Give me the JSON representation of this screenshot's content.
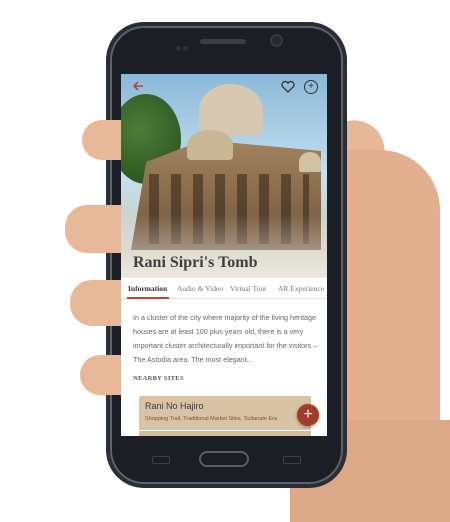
{
  "place": {
    "title": "Rani Sipri's Tomb"
  },
  "toolbar": {
    "back_icon": "arrow-left-icon",
    "favorite_icon": "heart-icon",
    "add_icon": "plus-circle-icon"
  },
  "tabs": [
    {
      "label": "Information",
      "active": true
    },
    {
      "label": "Audio & Video",
      "active": false
    },
    {
      "label": "Virtual Tour",
      "active": false
    },
    {
      "label": "AR Experience",
      "active": false
    }
  ],
  "description": "In a cluster of the city where majority of the living heritage houses are at least 100 plus years old, there is a very important cluster architecturally important for the visitors – The Astodia area. The most elegant...",
  "nearby": {
    "heading": "NEARBY SITES",
    "items": [
      {
        "name": "Rani No Hajiro",
        "tags": "Shopping Trail, Traditional Market Sites, Sultanate Era"
      }
    ]
  },
  "fab": {
    "label": "+"
  },
  "colors": {
    "accent": "#b5473a",
    "card": "#d9c3a5",
    "fab": "#a23b2a"
  }
}
